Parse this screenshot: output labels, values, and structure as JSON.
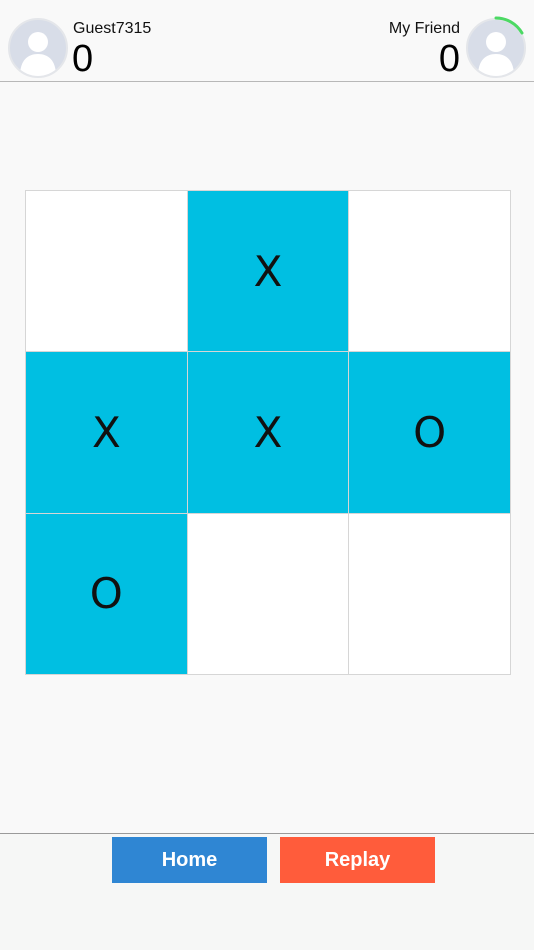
{
  "players": {
    "left": {
      "name": "Guest7315",
      "score": "0"
    },
    "right": {
      "name": "My Friend",
      "score": "0"
    }
  },
  "board": {
    "cells": [
      [
        "",
        "X",
        ""
      ],
      [
        "X",
        "X",
        "O"
      ],
      [
        "O",
        "",
        ""
      ]
    ]
  },
  "buttons": {
    "home": "Home",
    "replay": "Replay"
  },
  "colors": {
    "filled_cell": "#00bfe2",
    "empty_cell": "#ffffff",
    "home_button": "#2f86d3",
    "replay_button": "#ff5c3b",
    "timer_ring": "#4cd964"
  },
  "icons": {
    "avatar": "person-silhouette-icon"
  }
}
